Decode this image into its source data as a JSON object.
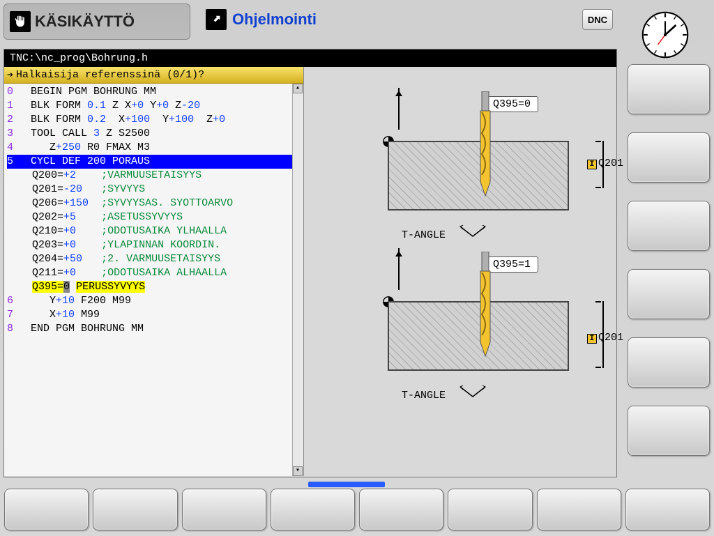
{
  "mode_tab": {
    "label": "KÄSIKÄYTTÖ",
    "icon": "hand-icon"
  },
  "prog_tab": {
    "label": "Ohjelmointi",
    "icon": "return-icon"
  },
  "dnc_label": "DNC",
  "file_path": "TNC:\\nc_prog\\Bohrung.h",
  "prompt": "Halkaisija referenssinä (0/1)?",
  "code_lines": [
    {
      "n": "0",
      "t": "BEGIN PGM BOHRUNG MM"
    },
    {
      "n": "1",
      "t": "BLK FORM ",
      "a": "0.1",
      "b": " Z X",
      "c": "+0",
      "d": " Y",
      "e": "+0",
      "f": " Z",
      "g": "-20"
    },
    {
      "n": "2",
      "t": "BLK FORM ",
      "a": "0.2",
      "b": "  X",
      "c": "+100",
      "d": "  Y",
      "e": "+100",
      "f": "  Z",
      "g": "+0"
    },
    {
      "n": "3",
      "t": "TOOL CALL ",
      "a": "3",
      "b": " Z S2500"
    },
    {
      "n": "4",
      "t": "   Z",
      "a": "+250",
      "b": " R0 FMAX M3"
    },
    {
      "n": "5",
      "t": "CYCL DEF 200 PORAUS",
      "selected": true
    },
    {
      "param": "Q200=",
      "val": "+2",
      "cmt": ";VARMUUSETAISYYS"
    },
    {
      "param": "Q201=",
      "val": "-20",
      "cmt": ";SYVYYS"
    },
    {
      "param": "Q206=",
      "val": "+150",
      "cmt": ";SYVYYSAS. SYOTTOARVO"
    },
    {
      "param": "Q202=",
      "val": "+5",
      "cmt": ";ASETUSSYVYYS"
    },
    {
      "param": "Q210=",
      "val": "+0",
      "cmt": ";ODOTUSAIKA YLHAALLA"
    },
    {
      "param": "Q203=",
      "val": "+0",
      "cmt": ";YLAPINNAN KOORDIN."
    },
    {
      "param": "Q204=",
      "val": "+50",
      "cmt": ";2. VARMUUSETAISYYS"
    },
    {
      "param": "Q211=",
      "val": "+0",
      "cmt": ";ODOTUSAIKA ALHAALLA"
    },
    {
      "param": "Q395=",
      "val": "0",
      "cmt": "PERUSSYVYYS",
      "active": true
    },
    {
      "n": "6",
      "t": "   Y",
      "a": "+10",
      "b": " F200 M99"
    },
    {
      "n": "7",
      "t": "   X",
      "a": "+10",
      "b": " M99"
    },
    {
      "n": "8",
      "t": "END PGM BOHRUNG MM"
    }
  ],
  "graphics": {
    "top": {
      "box": "Q395=0",
      "tangle": "T-ANGLE",
      "q": "Q201",
      "i": "I"
    },
    "bot": {
      "box": "Q395=1",
      "tangle": "T-ANGLE",
      "q": "Q201",
      "i": "I"
    }
  }
}
